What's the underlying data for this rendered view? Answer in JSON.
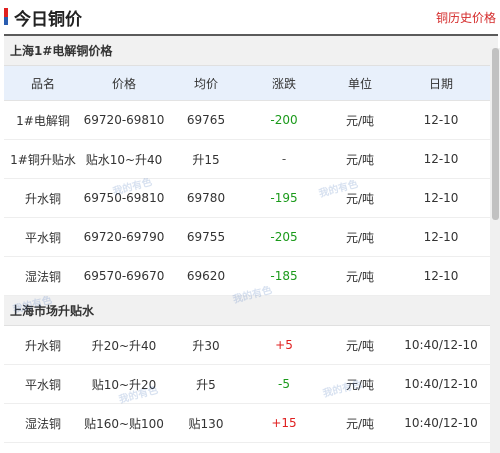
{
  "header": {
    "title": "今日铜价",
    "history_link": "铜历史价格"
  },
  "columns": [
    "品名",
    "价格",
    "均价",
    "涨跌",
    "单位",
    "日期"
  ],
  "section1": {
    "title": "上海1#电解铜价格",
    "rows": [
      {
        "name": "1#电解铜",
        "price": "69720-69810",
        "avg": "69765",
        "change": "-200",
        "change_color": "#1b9a1b",
        "unit": "元/吨",
        "date": "12-10"
      },
      {
        "name": "1#铜升贴水",
        "price": "贴水10~升40",
        "avg": "升15",
        "change": "-",
        "change_color": "#555555",
        "unit": "元/吨",
        "date": "12-10"
      },
      {
        "name": "升水铜",
        "price": "69750-69810",
        "avg": "69780",
        "change": "-195",
        "change_color": "#1b9a1b",
        "unit": "元/吨",
        "date": "12-10"
      },
      {
        "name": "平水铜",
        "price": "69720-69790",
        "avg": "69755",
        "change": "-205",
        "change_color": "#1b9a1b",
        "unit": "元/吨",
        "date": "12-10"
      },
      {
        "name": "湿法铜",
        "price": "69570-69670",
        "avg": "69620",
        "change": "-185",
        "change_color": "#1b9a1b",
        "unit": "元/吨",
        "date": "12-10"
      }
    ]
  },
  "section2": {
    "title": "上海市场升贴水",
    "rows": [
      {
        "name": "升水铜",
        "price": "升20~升40",
        "avg": "升30",
        "change": "+5",
        "change_color": "#e02020",
        "unit": "元/吨",
        "date": "10:40/12-10"
      },
      {
        "name": "平水铜",
        "price": "贴10~升20",
        "avg": "升5",
        "change": "-5",
        "change_color": "#1b9a1b",
        "unit": "元/吨",
        "date": "10:40/12-10"
      },
      {
        "name": "湿法铜",
        "price": "贴160~贴100",
        "avg": "贴130",
        "change": "+15",
        "change_color": "#e02020",
        "unit": "元/吨",
        "date": "10:40/12-10"
      }
    ]
  },
  "watermark_text": "我的有色"
}
